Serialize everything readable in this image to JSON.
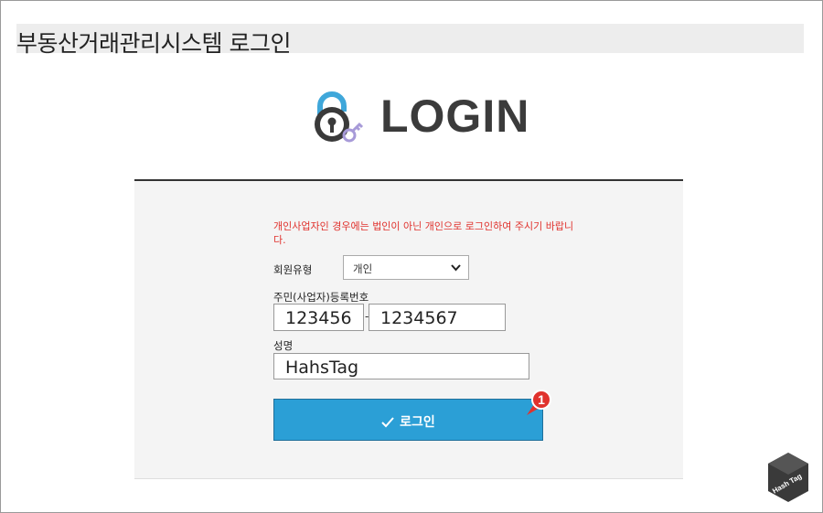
{
  "page": {
    "title": "부동산거래관리시스템 로그인"
  },
  "logo": {
    "text": "LOGIN",
    "icon": "padlock-icon"
  },
  "form": {
    "notice": "개인사업자인 경우에는 법인이 아닌 개인으로 로그인하여 주시기 바랍니다.",
    "member_type_label": "회원유형",
    "member_type_value": "개인",
    "rrn_label": "주민(사업자)등록번호",
    "rrn_first": "123456",
    "rrn_separator": "-",
    "rrn_second": "1234567",
    "name_label": "성명",
    "name_value": "HahsTag",
    "login_button_label": "로그인",
    "login_button_color": "#2b9fd6"
  },
  "annotation": {
    "step_number": "1",
    "badge_color": "#e0322d"
  },
  "watermark": {
    "text": "Hash Tag"
  },
  "colors": {
    "notice": "#e0322d",
    "panel_bg": "#f4f4f4"
  }
}
